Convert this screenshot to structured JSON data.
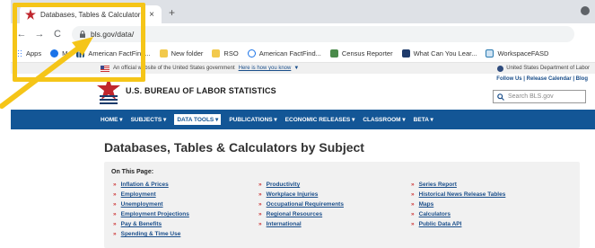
{
  "browser": {
    "tab_title": "Databases, Tables & Calculator",
    "tab_close": "×",
    "new_tab": "+",
    "back_icon": "←",
    "forward_icon": "→",
    "reload_icon": "C",
    "url": "bls.gov/data/"
  },
  "bookmarks": [
    {
      "label": "Apps",
      "icon": "apps-grid-icon",
      "color": "#4285f4"
    },
    {
      "label": "M",
      "icon": "chrome-icon",
      "color": "#1a73e8"
    },
    {
      "label": "American FactFind...",
      "icon": "factfinder-icon",
      "color": "#1f4e79"
    },
    {
      "label": "New folder",
      "icon": "folder-icon",
      "color": "#f2c94c"
    },
    {
      "label": "RSO",
      "icon": "folder-icon",
      "color": "#f2c94c"
    },
    {
      "label": "American FactFind...",
      "icon": "search-icon",
      "color": "#1a73e8"
    },
    {
      "label": "Census Reporter",
      "icon": "census-icon",
      "color": "#4a8a4a"
    },
    {
      "label": "What Can You Lear...",
      "icon": "cb-icon",
      "color": "#1f3b6b"
    },
    {
      "label": "WorkspaceFASD",
      "icon": "workspace-icon",
      "color": "#2a7ab0"
    }
  ],
  "gov_banner": {
    "text": "An official website of the United States government",
    "link": "Here is how you know",
    "dol": "United States Department of Labor"
  },
  "header": {
    "site_name": "U.S. BUREAU OF LABOR STATISTICS",
    "util_links": "Follow Us | Release Calendar | Blog",
    "search_placeholder": "Search BLS.gov"
  },
  "nav": [
    {
      "label": "HOME ▾",
      "active": false
    },
    {
      "label": "SUBJECTS ▾",
      "active": false
    },
    {
      "label": "DATA TOOLS ▾",
      "active": true
    },
    {
      "label": "PUBLICATIONS ▾",
      "active": false
    },
    {
      "label": "ECONOMIC RELEASES ▾",
      "active": false
    },
    {
      "label": "CLASSROOM ▾",
      "active": false
    },
    {
      "label": "BETA ▾",
      "active": false
    }
  ],
  "page": {
    "title": "Databases, Tables & Calculators by Subject",
    "on_this_page": "On This Page:",
    "col1": [
      "Inflation & Prices",
      "Employment",
      "Unemployment",
      "Employment Projections",
      "Pay & Benefits",
      "Spending & Time Use"
    ],
    "col2": [
      "Productivity",
      "Workplace Injuries",
      "Occupational Requirements",
      "Regional Resources",
      "International"
    ],
    "col3": [
      "Series Report",
      "Historical News Release Tables",
      "Maps",
      "Calculators",
      "Public Data API"
    ]
  },
  "colors": {
    "nav_blue": "#135696",
    "highlight": "#f5c518",
    "link_blue": "#1a4e8a",
    "bullet_red": "#cc3333"
  }
}
